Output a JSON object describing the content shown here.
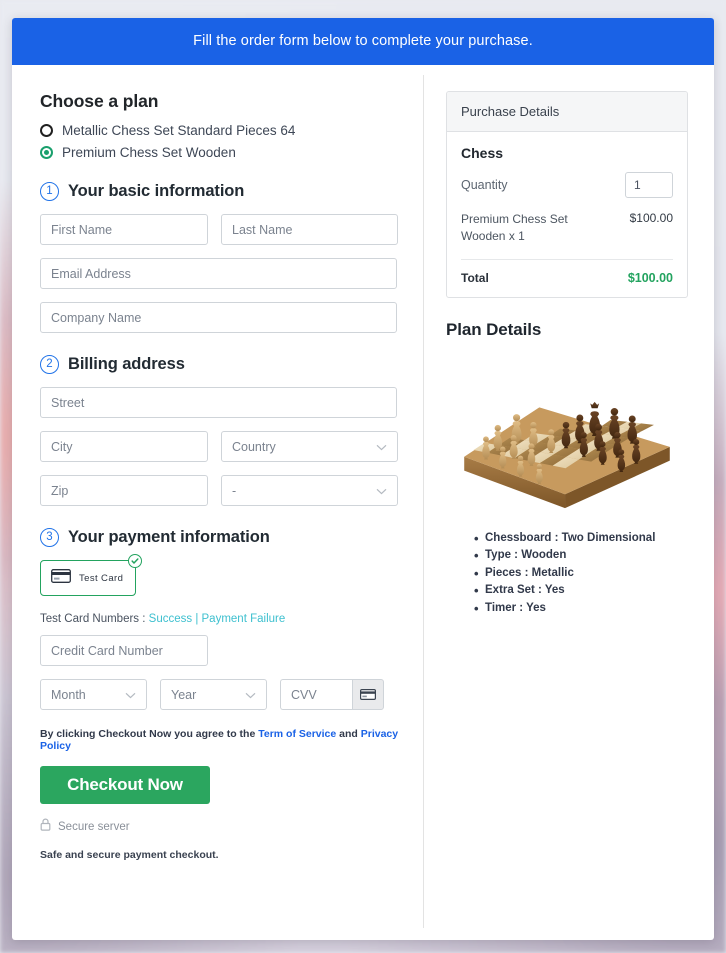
{
  "banner": {
    "text": "Fill the order form below to complete your purchase."
  },
  "plan_chooser": {
    "heading": "Choose a plan",
    "options": [
      {
        "label": "Metallic Chess Set Standard Pieces 64",
        "selected": false
      },
      {
        "label": "Premium Chess Set Wooden",
        "selected": true
      }
    ]
  },
  "basic_info": {
    "step": "1",
    "title": "Your basic information",
    "first_name_placeholder": "First Name",
    "last_name_placeholder": "Last Name",
    "email_placeholder": "Email Address",
    "company_placeholder": "Company Name"
  },
  "billing": {
    "step": "2",
    "title": "Billing address",
    "street_placeholder": "Street",
    "city_placeholder": "City",
    "country_placeholder": "Country",
    "zip_placeholder": "Zip",
    "state_placeholder": "-"
  },
  "payment": {
    "step": "3",
    "title": "Your payment information",
    "test_card_label": "Test  Card",
    "test_numbers_prefix": "Test Card Numbers : ",
    "success_link": "Success",
    "separator": " | ",
    "failure_link": "Payment Failure",
    "card_number_placeholder": "Credit Card Number",
    "month_placeholder": "Month",
    "year_placeholder": "Year",
    "cvv_placeholder": "CVV"
  },
  "footer": {
    "terms_prefix": "By clicking Checkout Now you agree to the ",
    "terms_link": "Term of Service",
    "terms_mid": " and ",
    "privacy_link": "Privacy Policy",
    "checkout_label": "Checkout Now",
    "secure_server": "Secure server",
    "safe_text": "Safe and secure payment checkout."
  },
  "purchase_details": {
    "panel_title": "Purchase Details",
    "product_title": "Chess",
    "quantity_label": "Quantity",
    "quantity_value": "1",
    "line_item_name": "Premium Chess Set Wooden x 1",
    "line_item_price": "$100.00",
    "total_label": "Total",
    "total_value": "$100.00"
  },
  "plan_details": {
    "heading": "Plan Details",
    "image_alt": "wooden-chessboard-photo",
    "features": [
      "Chessboard : Two Dimensional",
      "Type : Wooden",
      "Pieces : Metallic",
      "Extra Set : Yes",
      "Timer : Yes"
    ]
  },
  "colors": {
    "banner_blue": "#1a62e6",
    "accent_green": "#2ba65f",
    "radio_green": "#1aa06d",
    "link_teal": "#3ec0cf",
    "link_blue": "#1a62e6",
    "step_blue": "#2173e8"
  }
}
